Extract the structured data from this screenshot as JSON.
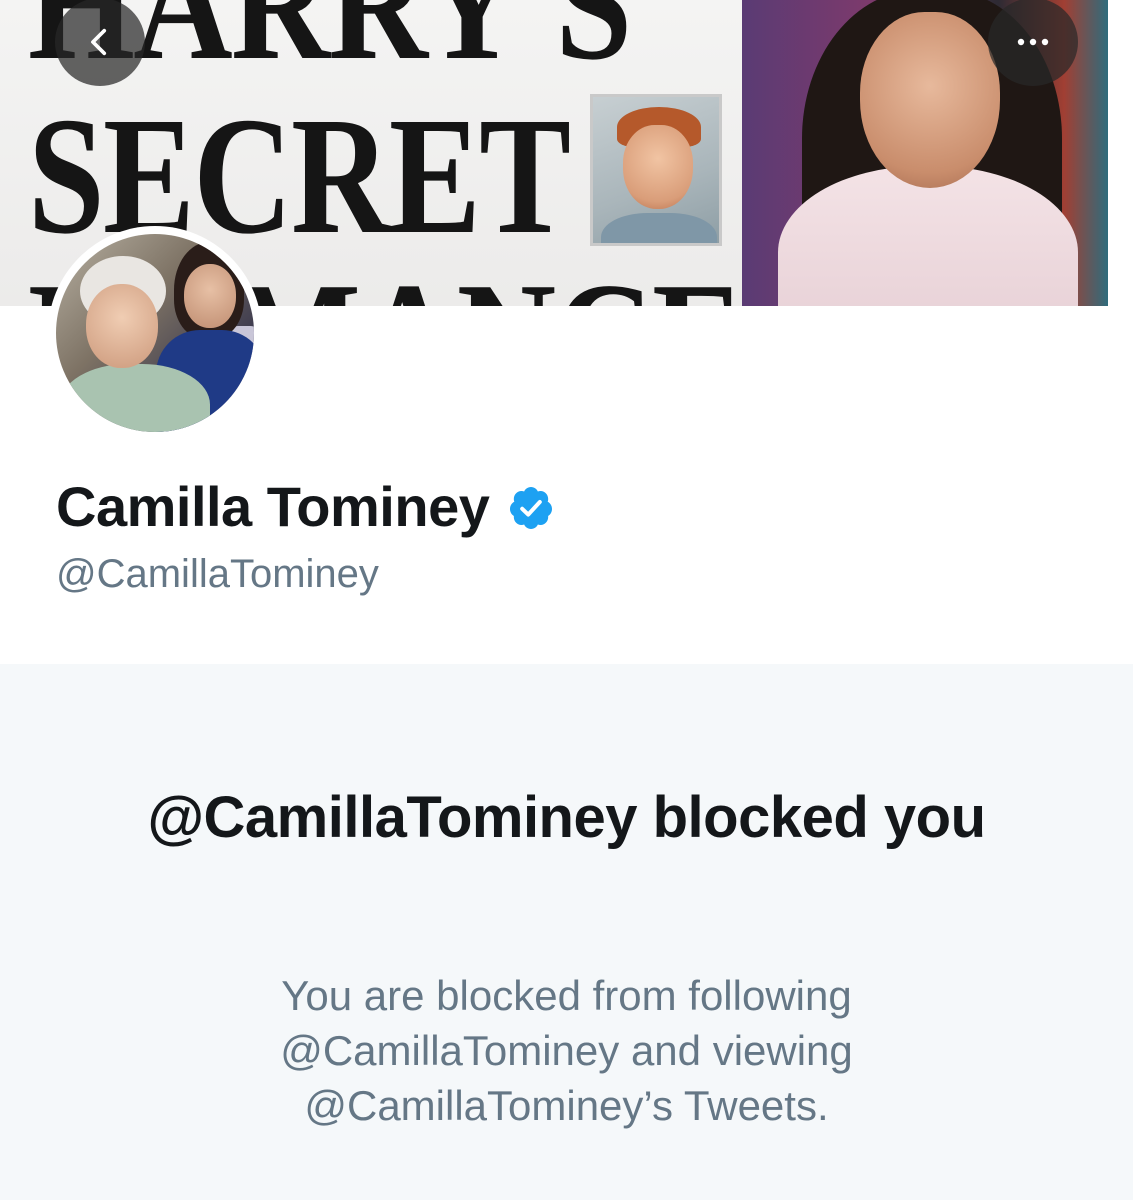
{
  "banner": {
    "headline_lines": [
      "HARRY'S",
      "SECRET",
      "ROMANCE"
    ]
  },
  "icons": {
    "back": "chevron-left-icon",
    "more": "more-horizontal-icon",
    "verified": "verified-badge-icon"
  },
  "profile": {
    "display_name": "Camilla Tominey",
    "handle": "@CamillaTominey",
    "verified": true
  },
  "blocked": {
    "title": "@CamillaTominey blocked you",
    "message": "You are blocked from following @CamillaTominey and viewing @CamillaTominey’s Tweets."
  },
  "colors": {
    "verified_blue": "#1da1f2",
    "text_primary": "#14171a",
    "text_secondary": "#657786",
    "panel_background": "#f5f8fa"
  }
}
